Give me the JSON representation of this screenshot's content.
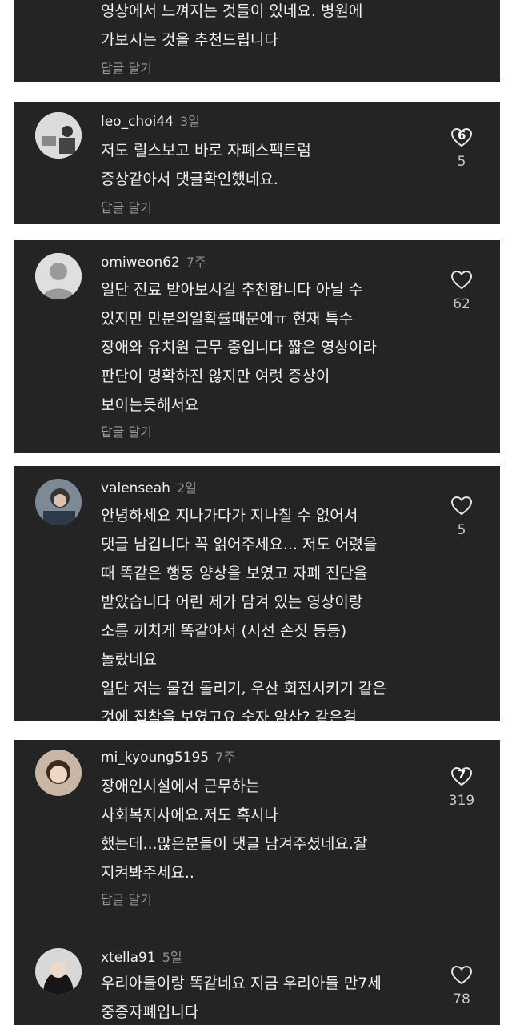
{
  "top": {
    "text": "영상에서 느껴지는 것들이 있네요. 병원에\n가보시는 것을 추천드립니다",
    "reply": "답글 달기"
  },
  "comments": [
    {
      "username": "leo_choi44",
      "time": "3일",
      "text": "저도 릴스보고 바로 자폐스펙트럼\n증상같아서 댓글확인했네요.",
      "reply": "답글 달기",
      "likes": "5",
      "badge": "6"
    },
    {
      "username": "omiweon62",
      "time": "7주",
      "text": "일단 진료 받아보시길 추천합니다 아닐 수\n있지만 만분의일확률때문에ㅠ 현재 특수\n장애와 유치원 근무 중입니다  짧은 영상이라\n판단이 명확하진 않지만 여럿 증상이\n보이는듯해서요",
      "reply": "답글 달기",
      "likes": "62"
    },
    {
      "username": "valenseah",
      "time": "2일",
      "text": "안녕하세요 지나가다가 지나칠 수 없어서\n댓글 남깁니다 꼭 읽어주세요... 저도 어렸을\n때 똑같은 행동 양상을 보였고 자폐 진단을\n받았습니다 어린 제가 담겨 있는 영상이랑\n소름 끼치게 똑같아서 (시선 손짓 등등)\n놀랐네요\n일단 저는 물건 돌리기, 우산 회전시키기 같은\n것에 집착을 보였고요 숫자 암산? 같은걸",
      "likes": "5"
    },
    {
      "username": "mi_kyoung5195",
      "time": "7주",
      "text": "장애인시설에서 근무하는\n사회복지사에요.저도 혹시나\n했는데...많은분들이 댓글 남겨주셨네요.잘\n지켜봐주세요..",
      "reply": "답글 달기",
      "likes": "319",
      "badge": "7"
    },
    {
      "username": "xtella91",
      "time": "5일",
      "text": "우리아들이랑 똑같네요 지금 우리아들 만7세\n중증자폐입니다",
      "likes": "78"
    }
  ]
}
